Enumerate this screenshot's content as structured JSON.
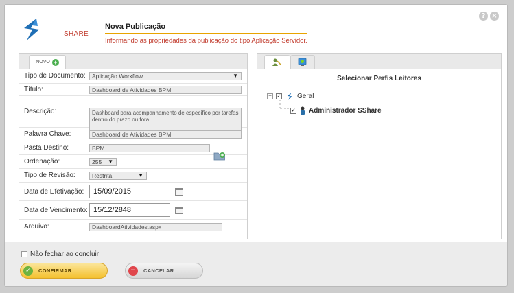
{
  "header": {
    "brand": "SHARE",
    "title": "Nova Publicação",
    "subtitle": "Informando as propriedades da publicação do tipo Aplicação Servidor.",
    "help_icon": "?",
    "close_icon": "×"
  },
  "tabs": {
    "novo": "NOVO"
  },
  "form": {
    "tipo_label": "Tipo de Documento:",
    "tipo_value": "Aplicação Workflow",
    "titulo_label": "Título:",
    "titulo_value": "Dashboard de Atividades BPM",
    "descricao_label": "Descrição:",
    "descricao_value": "Dashboard para acompanhamento de específico por tarefas dentro do prazo ou fora.",
    "palavra_label": "Palavra Chave:",
    "palavra_value": "Dashboard de Atividades BPM",
    "pasta_label": "Pasta Destino:",
    "pasta_value": "BPM",
    "ordenacao_label": "Ordenação:",
    "ordenacao_value": "255",
    "revisao_label": "Tipo de Revisão:",
    "revisao_value": "Restrita",
    "efetivacao_label": "Data de Efetivação:",
    "efetivacao_value": "15/09/2015",
    "vencimento_label": "Data de Vencimento:",
    "vencimento_value": "15/12/2848",
    "arquivo_label": "Arquivo:",
    "arquivo_value": "DashboardAtividades.aspx"
  },
  "perfis": {
    "title": "Selecionar Perfis Leitores",
    "root": "Geral",
    "child": "Administrador SShare"
  },
  "footer": {
    "nao_fechar": "Não fechar ao concluir",
    "confirmar": "CONFIRMAR",
    "cancelar": "CANCELAR"
  },
  "colors": {
    "accent": "#f4c12f",
    "brand": "#c0392b",
    "logo": "#1f6fb5"
  }
}
